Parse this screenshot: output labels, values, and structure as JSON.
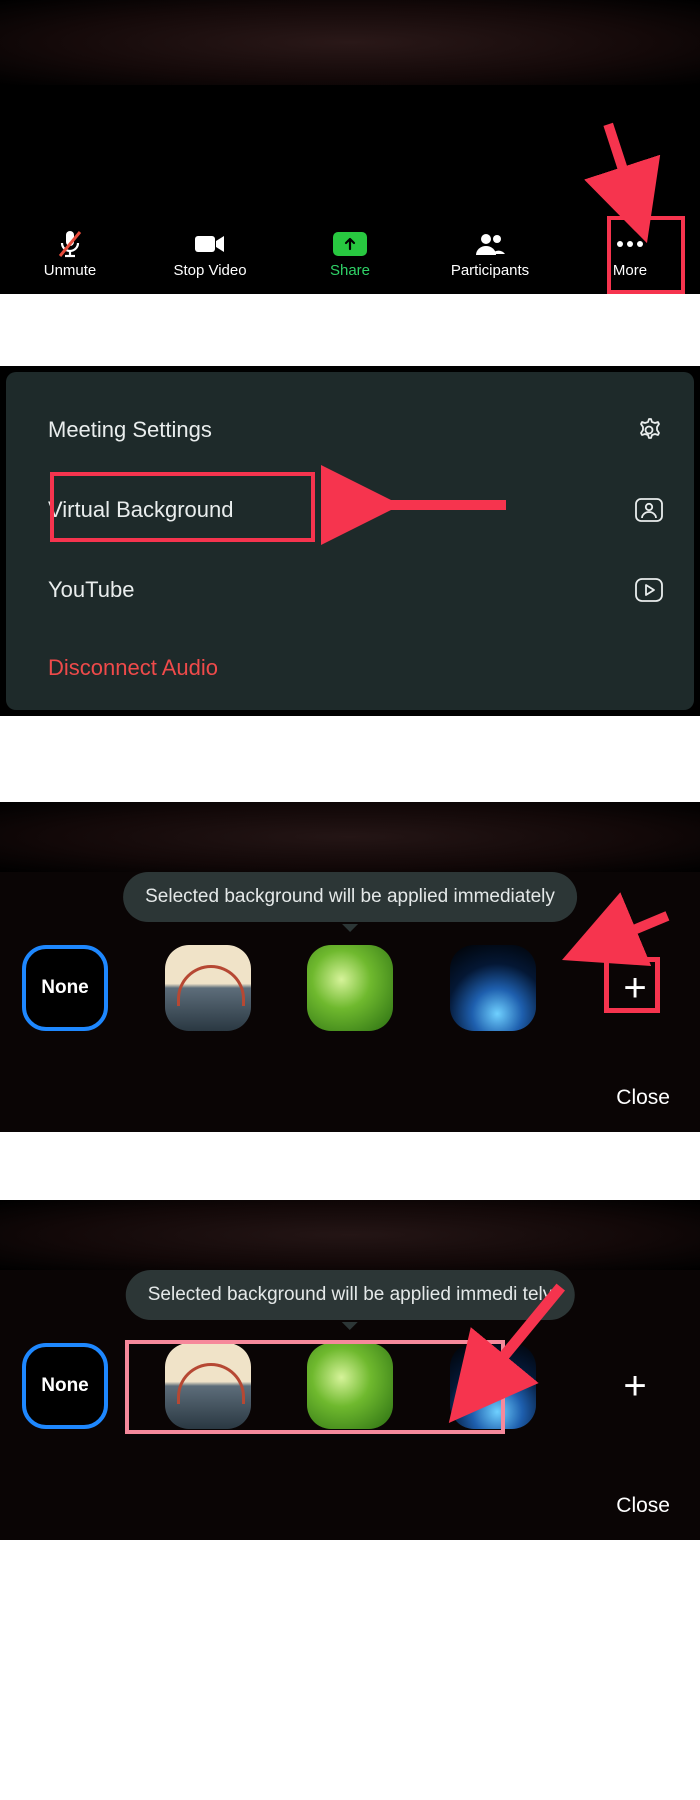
{
  "toolbar": {
    "unmute_label": "Unmute",
    "stopvideo_label": "Stop Video",
    "share_label": "Share",
    "participants_label": "Participants",
    "more_label": "More"
  },
  "menu": {
    "meeting_settings": "Meeting Settings",
    "virtual_background": "Virtual Background",
    "youtube": "YouTube",
    "disconnect_audio": "Disconnect Audio"
  },
  "vb": {
    "tooltip": "Selected background will be applied immediately",
    "none_label": "None",
    "plus_label": "+",
    "close_label": "Close",
    "tooltip_4": "Selected background will be applied immedi  tely"
  },
  "annotation_color": "#f6344e"
}
